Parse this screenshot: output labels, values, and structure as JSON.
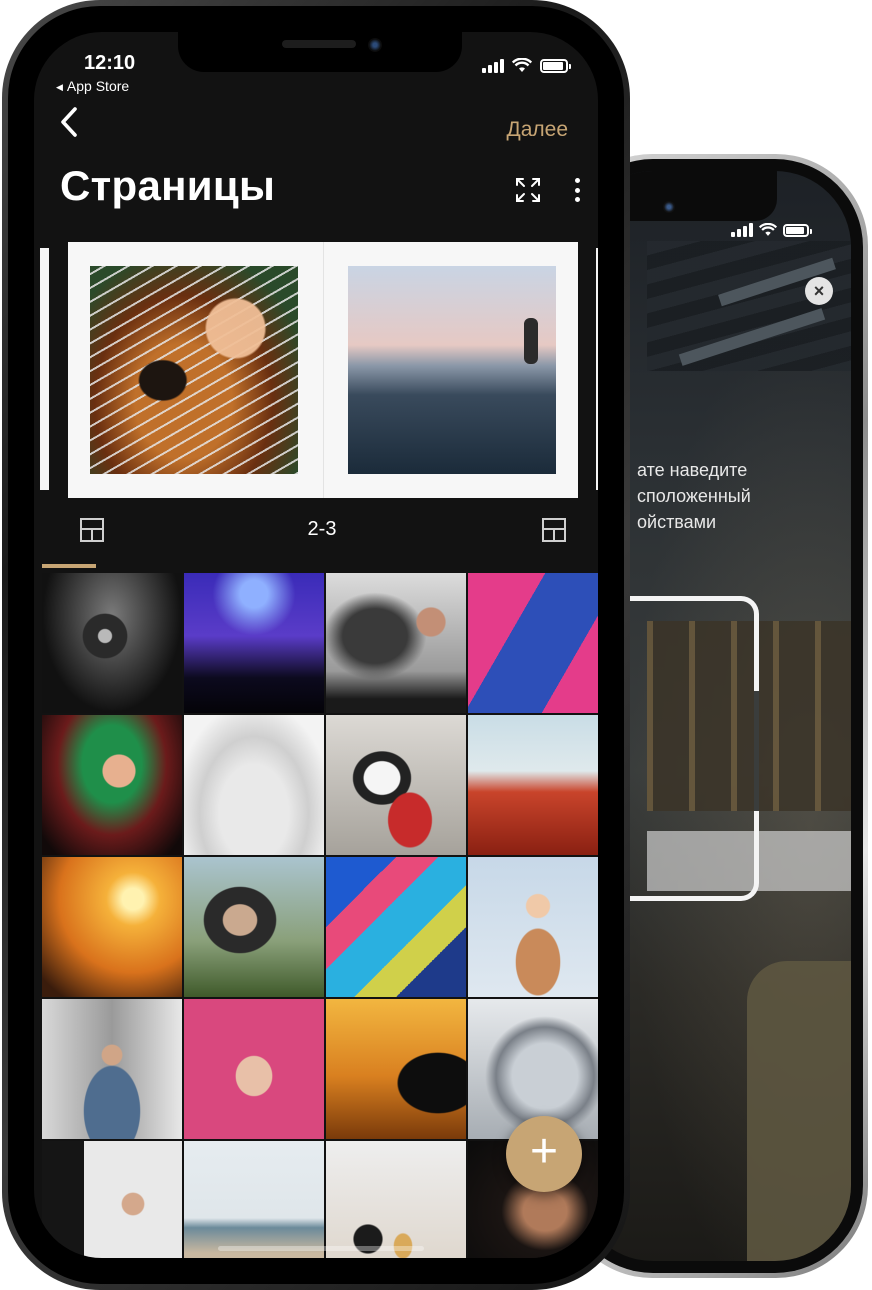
{
  "status_bar": {
    "time": "12:10",
    "back_to_app": "App Store",
    "icons": [
      "cellular-signal-icon",
      "wifi-icon",
      "battery-icon"
    ],
    "battery_level": 0.9
  },
  "nav": {
    "back_icon": "chevron-left-icon",
    "next_label": "Далее",
    "accent_color": "#c7a574"
  },
  "header": {
    "title": "Страницы",
    "expand_icon": "expand-icon",
    "more_icon": "more-vertical-icon"
  },
  "spread": {
    "page_number": "2-3",
    "left_photo": "guitar-photo",
    "right_photo": "surfer-photo",
    "layout_icons": [
      "layout-icon",
      "layout-icon"
    ]
  },
  "gallery": {
    "photos": [
      "singer-on-stage-bw",
      "concert-crowd",
      "man-smoking",
      "skater-colorful-wall",
      "woman-microphone-neon",
      "child-with-laptop-sofa",
      "wedding-couple-red-car",
      "kids-tulip-field",
      "sunset-father-child",
      "woman-taking-photo",
      "graffiti-bicycle",
      "toddler-wooden-wagon",
      "man-denim-jacket",
      "hand-tattoo-pink",
      "silhouette-sunset",
      "car-open-door",
      "woman-hat-window",
      "woman-beach",
      "coffee-cookies-phone",
      "woman-portrait-dark"
    ],
    "add_button_icon": "plus-icon"
  },
  "scanner_screen": {
    "hint_text": "ате наведите\nсположенный\nойствами",
    "close_icon": "close-icon"
  }
}
